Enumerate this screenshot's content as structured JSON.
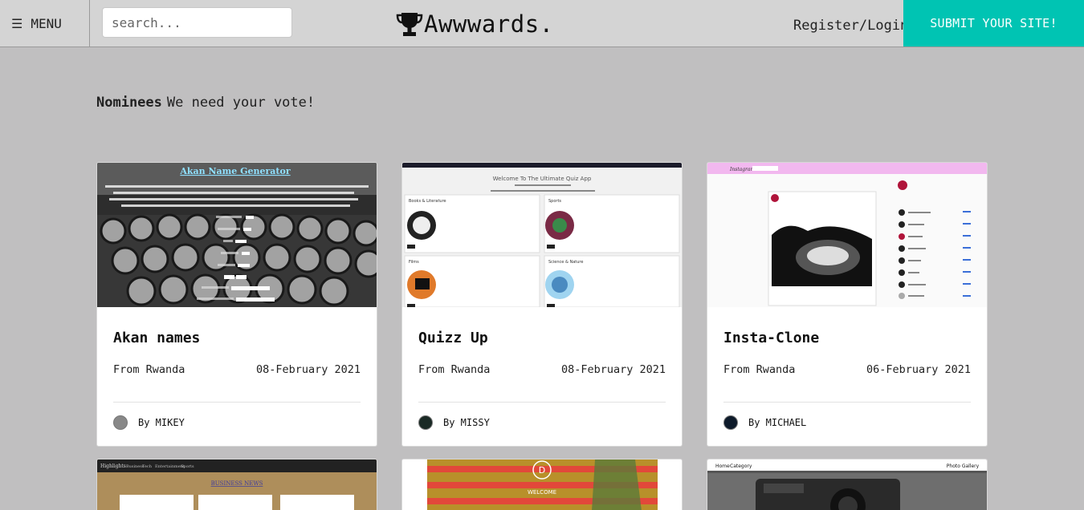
{
  "header": {
    "menu_label": "MENU",
    "search_placeholder": "search...",
    "brand": "Awwwards.",
    "register_label": "Register/Login",
    "submit_label": "SUBMIT YOUR SITE!"
  },
  "section": {
    "nominees_label": "Nominees",
    "tagline": "We need your vote!"
  },
  "projects": [
    {
      "title": "Akan names",
      "from": "From Rwanda",
      "date": "08-February 2021",
      "by": "By MIKEY",
      "thumb": {
        "heading": "Akan Name Generator"
      }
    },
    {
      "title": "Quizz Up",
      "from": "From Rwanda",
      "date": "08-February 2021",
      "by": "By MISSY",
      "thumb": {
        "heading": "Welcome To The Ultimate Quiz App",
        "categories": [
          "Books & Literature",
          "Sports",
          "Films",
          "Science & Nature"
        ]
      }
    },
    {
      "title": "Insta-Clone",
      "from": "From Rwanda",
      "date": "06-February 2021",
      "by": "By MICHAEL",
      "thumb": {
        "brand": "Instagram"
      }
    }
  ],
  "partial_cards": [
    {
      "thumb": {
        "nav": [
          "Highlights",
          "Business",
          "Tech",
          "Entertainment",
          "Sports"
        ],
        "heading": "BUSINESS NEWS"
      }
    },
    {
      "thumb": {
        "logo": "D",
        "heading": "WELCOME"
      }
    },
    {
      "thumb": {
        "nav": [
          "Home",
          "Category",
          "Photo Gallery"
        ]
      }
    }
  ],
  "colors": {
    "accent": "#00c4b3",
    "background": "#c0bfc0"
  }
}
